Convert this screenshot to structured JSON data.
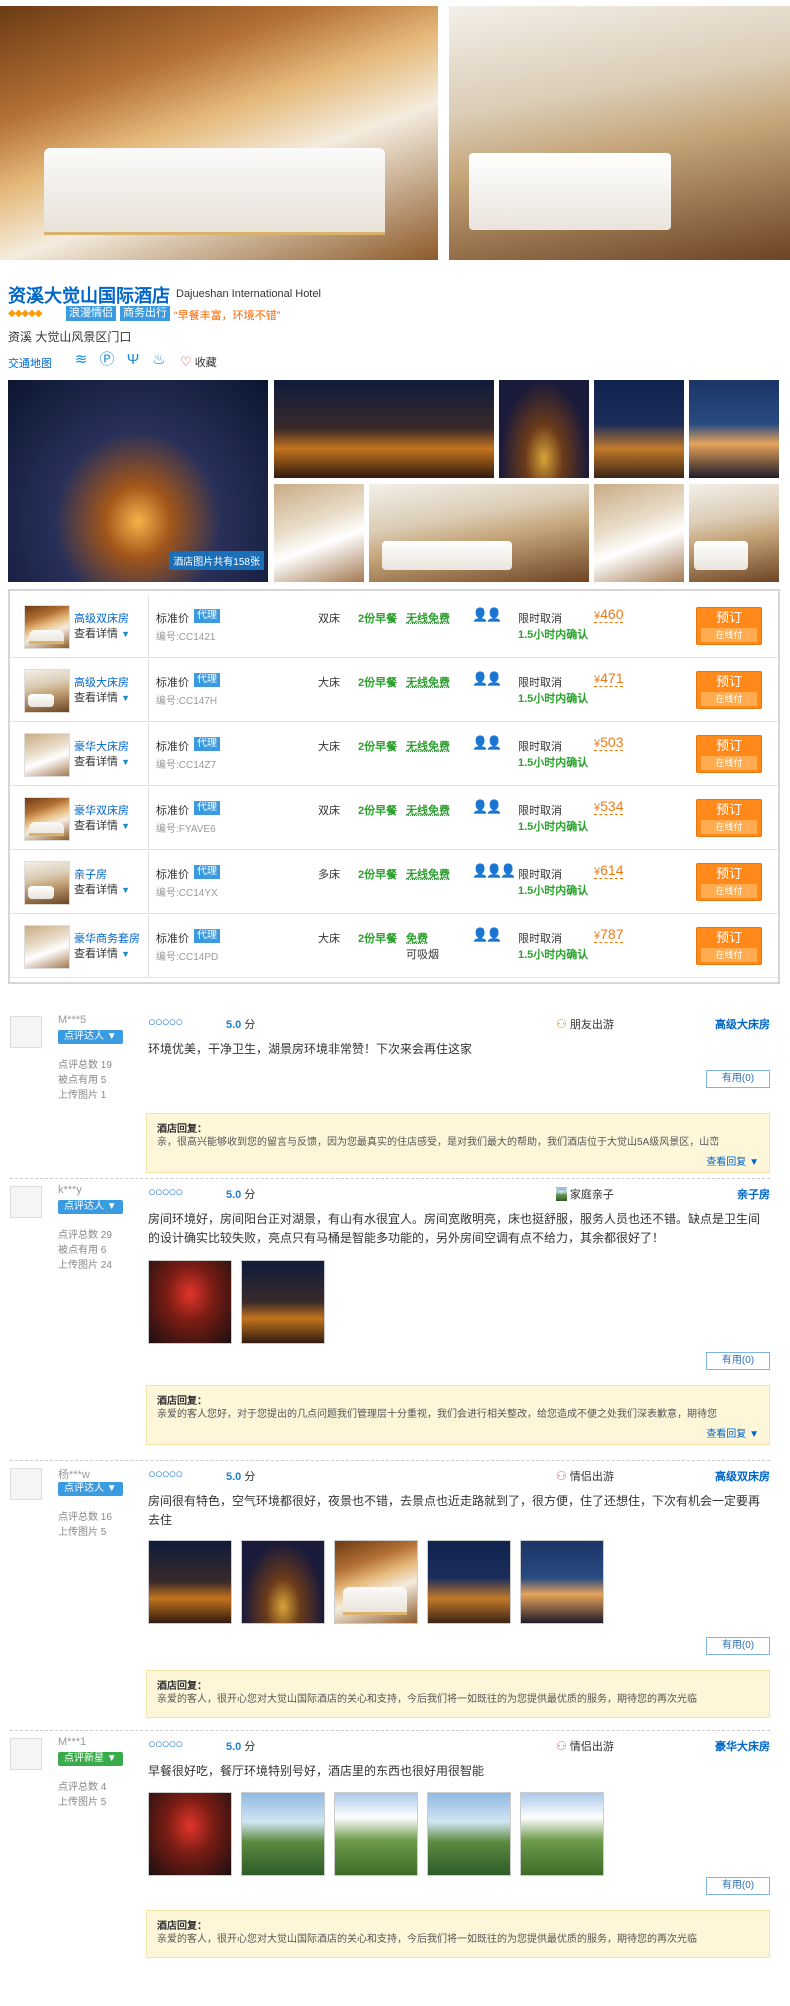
{
  "hotel": {
    "name_cn": "资溪大觉山国际酒店",
    "name_en": "Dajueshan International Hotel",
    "stars": "◆◆◆◆◆",
    "tags": [
      "浪漫情侣",
      "商务出行"
    ],
    "slogan": "“早餐丰富，环境不错”",
    "address": "资溪 大觉山风景区门口",
    "traffic_map": "交通地图",
    "favorite": "收藏",
    "photo_count": "酒店图片共有158张",
    "facility_icons": [
      "wifi-icon",
      "parking-icon",
      "restaurant-icon",
      "pool-icon"
    ]
  },
  "rooms": [
    {
      "name": "高级双床房",
      "detail": "查看详情",
      "price_label": "标准价",
      "agent": "代理",
      "code": "编号:CC1421",
      "bed": "双床",
      "breakfast": "2份早餐",
      "wifi": "无线免费",
      "wifi_sub": "",
      "persons": "👤👤",
      "cancel": "限时取消",
      "confirm": "1.5小时内确认",
      "yen": "¥",
      "price": "460",
      "book": "预订",
      "pay": "在线付"
    },
    {
      "name": "高级大床房",
      "detail": "查看详情",
      "price_label": "标准价",
      "agent": "代理",
      "code": "编号:CC147H",
      "bed": "大床",
      "breakfast": "2份早餐",
      "wifi": "无线免费",
      "wifi_sub": "",
      "persons": "👤👤",
      "cancel": "限时取消",
      "confirm": "1.5小时内确认",
      "yen": "¥",
      "price": "471",
      "book": "预订",
      "pay": "在线付"
    },
    {
      "name": "豪华大床房",
      "detail": "查看详情",
      "price_label": "标准价",
      "agent": "代理",
      "code": "编号:CC14Z7",
      "bed": "大床",
      "breakfast": "2份早餐",
      "wifi": "无线免费",
      "wifi_sub": "",
      "persons": "👤👤",
      "cancel": "限时取消",
      "confirm": "1.5小时内确认",
      "yen": "¥",
      "price": "503",
      "book": "预订",
      "pay": "在线付"
    },
    {
      "name": "豪华双床房",
      "detail": "查看详情",
      "price_label": "标准价",
      "agent": "代理",
      "code": "编号:FYAVE6",
      "bed": "双床",
      "breakfast": "2份早餐",
      "wifi": "无线免费",
      "wifi_sub": "",
      "persons": "👤👤",
      "cancel": "限时取消",
      "confirm": "1.5小时内确认",
      "yen": "¥",
      "price": "534",
      "book": "预订",
      "pay": "在线付"
    },
    {
      "name": "亲子房",
      "detail": "查看详情",
      "price_label": "标准价",
      "agent": "代理",
      "code": "编号:CC14YX",
      "bed": "多床",
      "breakfast": "2份早餐",
      "wifi": "无线免费",
      "wifi_sub": "",
      "persons": "👤👤👤",
      "cancel": "限时取消",
      "confirm": "1.5小时内确认",
      "yen": "¥",
      "price": "614",
      "book": "预订",
      "pay": "在线付"
    },
    {
      "name": "豪华商务套房",
      "detail": "查看详情",
      "price_label": "标准价",
      "agent": "代理",
      "code": "编号:CC14PD",
      "bed": "大床",
      "breakfast": "2份早餐",
      "wifi": "免费",
      "wifi_sub": "可吸烟",
      "persons": "👤👤",
      "cancel": "限时取消",
      "confirm": "1.5小时内确认",
      "yen": "¥",
      "price": "787",
      "book": "预订",
      "pay": "在线付"
    }
  ],
  "reviews": [
    {
      "user": "M***5",
      "badge": "点评达人",
      "stats": [
        "点评总数 19",
        "被点有用 5",
        "上传图片 1"
      ],
      "rating": "○○○○○",
      "score": "5.0",
      "score_unit": "分",
      "trip": "朋友出游",
      "room": "高级大床房",
      "text": "环境优美，干净卫生，湖景房环境非常赞！下次来会再住这家",
      "useful": "有用(0)",
      "reply_title": "酒店回复：",
      "reply": "亲，很高兴能够收到您的留言与反馈，因为您最真实的住店感受，是对我们最大的帮助，我们酒店位于大觉山5A级风景区，山峦",
      "reply_more": "查看回复 ▼"
    },
    {
      "user": "k***y",
      "badge": "点评达人",
      "stats": [
        "点评总数 29",
        "被点有用 6",
        "上传图片 24"
      ],
      "rating": "○○○○○",
      "score": "5.0",
      "score_unit": "分",
      "trip": "家庭亲子",
      "room": "亲子房",
      "text": "房间环境好，房间阳台正对湖景，有山有水很宜人。房间宽敞明亮，床也挺舒服，服务人员也还不错。缺点是卫生间的设计确实比较失败，亮点只有马桶是智能多功能的，另外房间空调有点不给力，其余都很好了！",
      "useful": "有用(0)",
      "reply_title": "酒店回复：",
      "reply": "亲爱的客人您好，对于您提出的几点问题我们管理层十分重视，我们会进行相关整改，给您造成不便之处我们深表歉意，期待您",
      "reply_more": "查看回复 ▼"
    },
    {
      "user": "杨***w",
      "badge": "点评达人",
      "stats": [
        "点评总数 16",
        "上传图片 5"
      ],
      "rating": "○○○○○",
      "score": "5.0",
      "score_unit": "分",
      "trip": "情侣出游",
      "room": "高级双床房",
      "text": "房间很有特色，空气环境都很好，夜景也不错，去景点也近走路就到了，很方便，住了还想住，下次有机会一定要再去住",
      "useful": "有用(0)",
      "reply_title": "酒店回复：",
      "reply": "亲爱的客人，很开心您对大觉山国际酒店的关心和支持，今后我们将一如既往的为您提供最优质的服务，期待您的再次光临",
      "reply_more": ""
    },
    {
      "user": "M***1",
      "badge": "点评新星",
      "stats": [
        "点评总数 4",
        "上传图片 5"
      ],
      "rating": "○○○○○",
      "score": "5.0",
      "score_unit": "分",
      "trip": "情侣出游",
      "room": "豪华大床房",
      "text": "早餐很好吃，餐厅环境特别号好，酒店里的东西也很好用很智能",
      "useful": "有用(0)",
      "reply_title": "酒店回复：",
      "reply": "亲爱的客人，很开心您对大觉山国际酒店的关心和支持，今后我们将一如既往的为您提供最优质的服务，期待您的再次光临",
      "reply_more": ""
    }
  ]
}
